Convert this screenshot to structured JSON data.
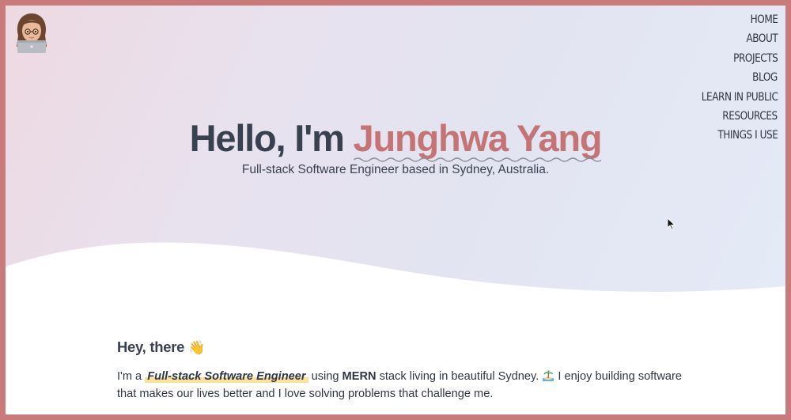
{
  "nav": {
    "items": [
      {
        "label": "HOME"
      },
      {
        "label": "ABOUT"
      },
      {
        "label": "PROJECTS"
      },
      {
        "label": "BLOG"
      },
      {
        "label": "LEARN IN PUBLIC"
      },
      {
        "label": "RESOURCES"
      },
      {
        "label": "THINGS I USE"
      }
    ]
  },
  "hero": {
    "greeting": "Hello, I'm ",
    "name": "Junghwa Yang",
    "subtitle": "Full-stack Software Engineer based in Sydney, Australia."
  },
  "about": {
    "heading": "Hey, there",
    "heading_emoji": "👋",
    "intro_prefix": "I'm a ",
    "intro_role": "Full-stack Software Engineer",
    "intro_using": " using ",
    "intro_stack": "MERN",
    "intro_rest_1": " stack living in beautiful Sydney. ",
    "intro_rest_2": " I enjoy building software that makes our lives better and I love solving problems that challenge me."
  },
  "icons": {
    "avatar": "memoji-avatar-with-laptop",
    "wave": "waving-hand-emoji",
    "island": "desert-island-emoji",
    "cursor": "mouse-pointer-icon"
  },
  "colors": {
    "frame": "#c97b7b",
    "accent_name": "#c47474",
    "heading_text": "#394150",
    "highlight": "#fbe29a"
  }
}
